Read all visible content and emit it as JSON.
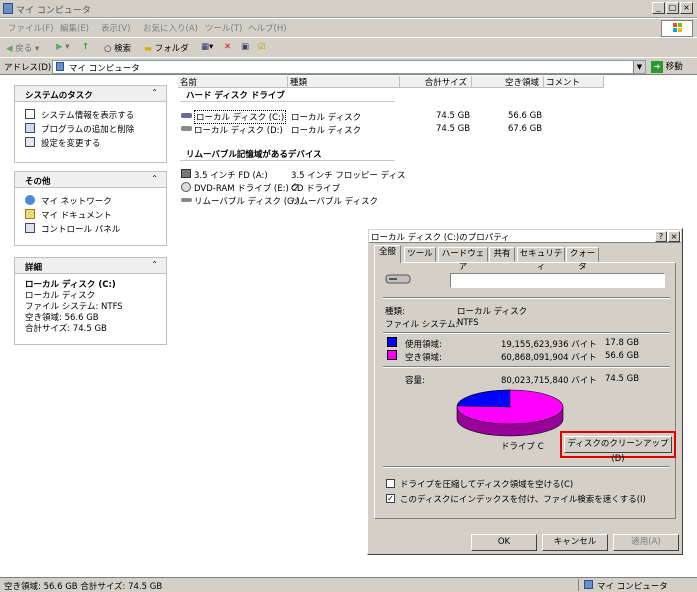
{
  "window": {
    "title": "マイ コンピュータ"
  },
  "menu": [
    "ファイル(F)",
    "編集(E)",
    "表示(V)",
    "お気に入り(A)",
    "ツール(T)",
    "ヘルプ(H)"
  ],
  "toolbar": {
    "back": "戻る",
    "search": "検索",
    "folders": "フォルダ"
  },
  "address": {
    "label": "アドレス(D)",
    "value": "マイ コンピュータ",
    "go": "移動"
  },
  "tasks": {
    "system": {
      "title": "システムのタスク",
      "items": [
        "システム情報を表示する",
        "プログラムの追加と削除",
        "設定を変更する"
      ]
    },
    "other": {
      "title": "その他",
      "items": [
        "マイ ネットワーク",
        "マイ ドキュメント",
        "コントロール パネル"
      ]
    },
    "details": {
      "title": "詳細",
      "name": "ローカル ディスク (C:)",
      "type": "ローカル ディスク",
      "fs": "ファイル システム: NTFS",
      "free": "空き領域: 56.6 GB",
      "total": "合計サイズ: 74.5 GB"
    }
  },
  "columns": [
    "名前",
    "種類",
    "合計サイズ",
    "空き領域",
    "コメント"
  ],
  "groups": {
    "hdd": "ハード ディスク ドライブ",
    "removable": "リムーバブル記憶域があるデバイス"
  },
  "drives": [
    {
      "name": "ローカル ディスク (C:)",
      "type": "ローカル ディスク",
      "total": "74.5 GB",
      "free": "56.6 GB"
    },
    {
      "name": "ローカル ディスク (D:)",
      "type": "ローカル ディスク",
      "total": "74.5 GB",
      "free": "67.6 GB"
    }
  ],
  "removables": [
    {
      "name": "3.5 インチ FD (A:)",
      "type": "3.5 インチ フロッピー ディスク"
    },
    {
      "name": "DVD-RAM ドライブ (E:)",
      "type": "CD ドライブ"
    },
    {
      "name": "リムーバブル ディスク (G:)",
      "type": "リムーバブル ディスク"
    }
  ],
  "dialog": {
    "title": "ローカル ディスク (C:)のプロパティ",
    "tabs": [
      "全般",
      "ツール",
      "ハードウェア",
      "共有",
      "セキュリティ",
      "クォータ"
    ],
    "type_label": "種類:",
    "type_value": "ローカル ディスク",
    "fs_label": "ファイル システム:",
    "fs_value": "NTFS",
    "used_label": "使用領域:",
    "used_bytes": "19,155,623,936 バイト",
    "used_gb": "17.8 GB",
    "free_label": "空き領域:",
    "free_bytes": "60,868,091,904 バイト",
    "free_gb": "56.6 GB",
    "cap_label": "容量:",
    "cap_bytes": "80,023,715,840 バイト",
    "cap_gb": "74.5 GB",
    "drive_label": "ドライブ C",
    "cleanup": "ディスクのクリーンアップ(D)",
    "compress": "ドライブを圧縮してディスク領域を空ける(C)",
    "index": "このディスクにインデックスを付け、ファイル検索を速くする(I)",
    "ok": "OK",
    "cancel": "キャンセル",
    "apply": "適用(A)",
    "used_fraction": 0.239,
    "colors": {
      "used": "#0000ff",
      "free": "#ff00ff",
      "highlight": "#e00000"
    }
  },
  "status": {
    "left": "空き領域: 56.6 GB 合計サイズ: 74.5 GB",
    "right": "マイ コンピュータ"
  }
}
